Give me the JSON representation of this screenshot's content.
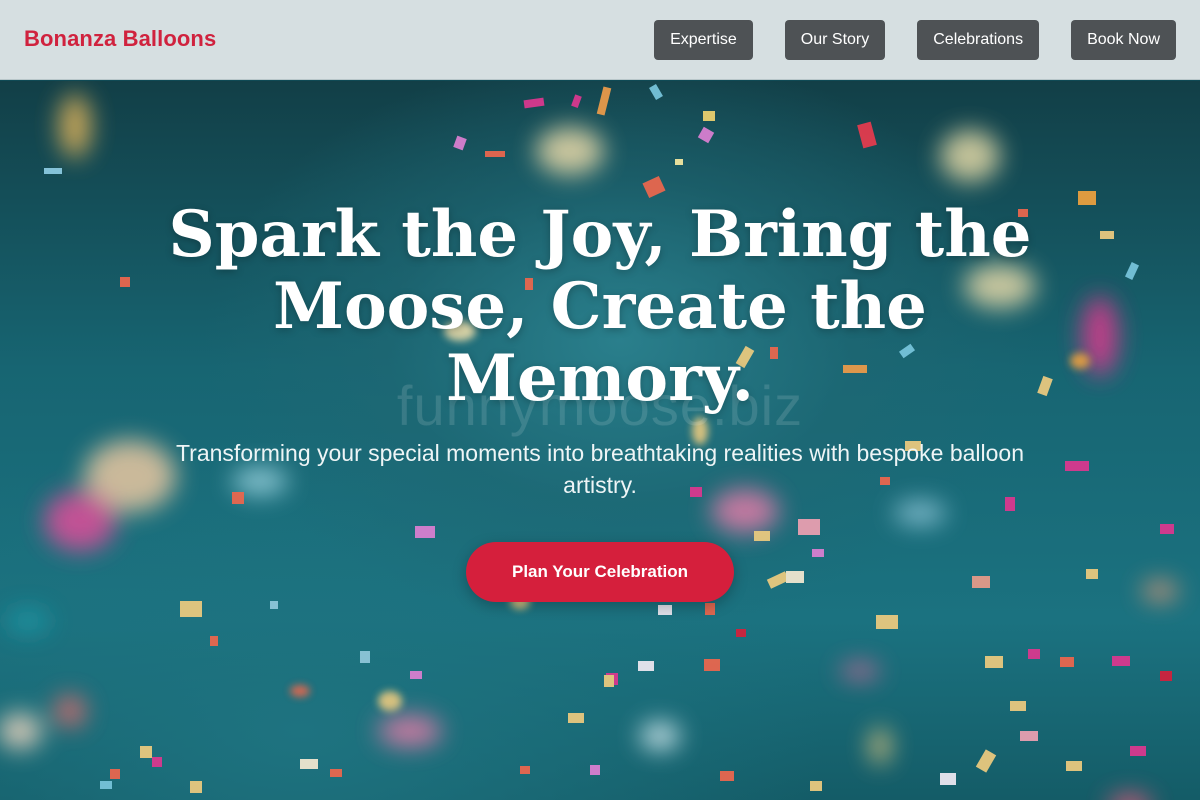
{
  "brand": {
    "name": "Bonanza Balloons",
    "color": "#d0223e"
  },
  "nav": {
    "items": [
      {
        "label": "Expertise"
      },
      {
        "label": "Our Story"
      },
      {
        "label": "Celebrations"
      },
      {
        "label": "Book Now"
      }
    ]
  },
  "hero": {
    "headline": "Spark the Joy, Bring the Moose, Create the Memory.",
    "subtitle": "Transforming your special moments into breathtaking realities with bespoke balloon artistry.",
    "cta_label": "Plan Your Celebration",
    "watermark": "funnymoose.biz",
    "background_image": "blurred-confetti-on-teal",
    "accent_color": "#d51f3c"
  }
}
